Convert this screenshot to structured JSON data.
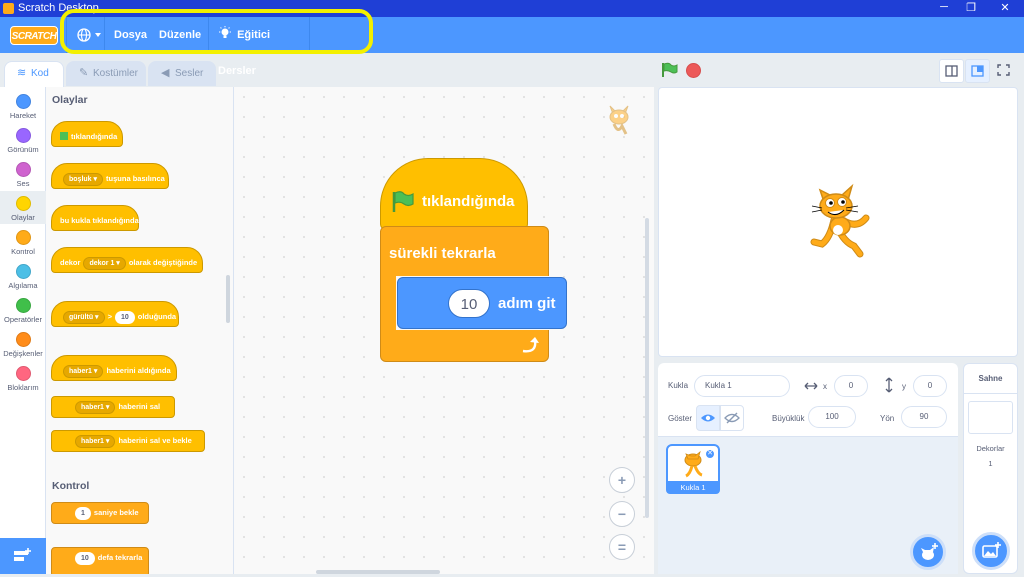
{
  "window": {
    "title": "Scratch Desktop",
    "controls": [
      "─",
      "❐",
      "✕"
    ]
  },
  "menubar": {
    "logo": "SCRATCH",
    "items": [
      {
        "label": "Dosya"
      },
      {
        "label": "Düzenle"
      },
      {
        "label": "Eğitici Dersler"
      }
    ]
  },
  "tabs": [
    {
      "label": "Kod",
      "active": true
    },
    {
      "label": "Kostümler",
      "active": false
    },
    {
      "label": "Sesler",
      "active": false
    }
  ],
  "categories": [
    {
      "label": "Hareket",
      "color": "#4c97ff"
    },
    {
      "label": "Görünüm",
      "color": "#9966ff"
    },
    {
      "label": "Ses",
      "color": "#cf63cf"
    },
    {
      "label": "Olaylar",
      "color": "#ffd500"
    },
    {
      "label": "Kontrol",
      "color": "#ffab19"
    },
    {
      "label": "Algılama",
      "color": "#4cbfe6"
    },
    {
      "label": "Operatörler",
      "color": "#40bf4a"
    },
    {
      "label": "Değişkenler",
      "color": "#ff8c1a"
    },
    {
      "label": "Bloklarım",
      "color": "#ff6680"
    }
  ],
  "palette": {
    "events_heading": "Olaylar",
    "control_heading": "Kontrol",
    "b_flag": "tıklandığında",
    "b_key_drop": "boşluk",
    "b_key_text": "tuşuna basılınca",
    "b_sprite_click": "bu kukla tıklandığında",
    "b_backdrop_a": "dekor",
    "b_backdrop_drop": "dekor 1",
    "b_backdrop_b": "olarak değiştiğinde",
    "b_loud_drop": "gürültü",
    "b_loud_gt": ">",
    "b_loud_val": "10",
    "b_loud_text": "olduğunda",
    "b_recv_drop": "haber1",
    "b_recv_text": "haberini aldığında",
    "b_bcast_drop": "haber1",
    "b_bcast_text": "haberini sal",
    "b_bcastw_drop": "haber1",
    "b_bcastw_text": "haberini sal ve bekle",
    "b_wait_val": "1",
    "b_wait_text": "saniye bekle",
    "b_repeat_val": "10",
    "b_repeat_text": "defa tekrarla"
  },
  "script": {
    "hat_label": "tıklandığında",
    "forever_label": "sürekli tekrarla",
    "move_value": "10",
    "move_label": "adım git"
  },
  "zoom": {
    "in": "+",
    "out": "−",
    "reset": "="
  },
  "sprite_info": {
    "sprite_label": "Kukla",
    "sprite_name": "Kukla 1",
    "x_label": "x",
    "x_value": "0",
    "y_label": "y",
    "y_value": "0",
    "show_label": "Göster",
    "size_label": "Büyüklük",
    "size_value": "100",
    "direction_label": "Yön",
    "direction_value": "90"
  },
  "sprite_list": [
    {
      "name": "Kukla 1",
      "selected": true
    }
  ],
  "stage_panel": {
    "title": "Sahne",
    "backdrops_label": "Dekorlar",
    "backdrops_count": "1"
  },
  "colors": {
    "accent": "#4c97ff",
    "events": "#ffbf00",
    "control": "#ffab19",
    "highlight": "#f3f000"
  }
}
